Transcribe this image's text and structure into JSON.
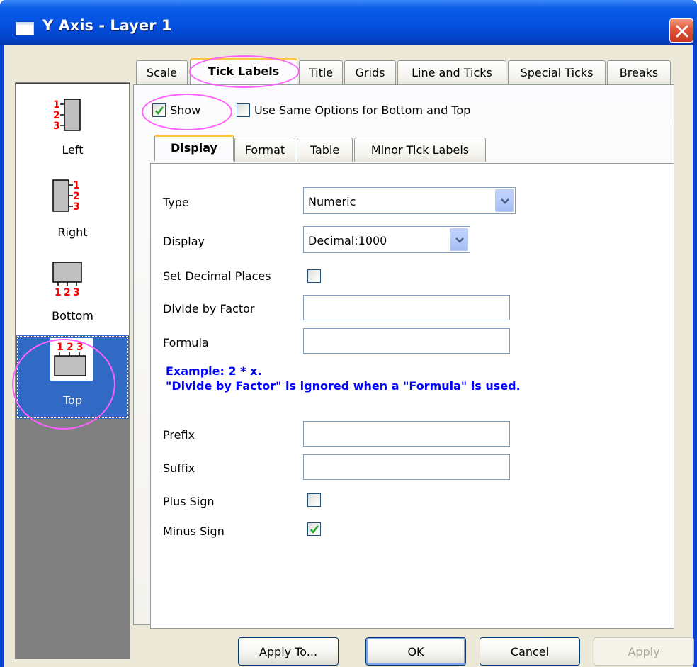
{
  "window": {
    "title": "Y Axis - Layer 1"
  },
  "sidebar": {
    "items": [
      {
        "label": "Left",
        "selected": false
      },
      {
        "label": "Right",
        "selected": false
      },
      {
        "label": "Bottom",
        "selected": false
      },
      {
        "label": "Top",
        "selected": true
      }
    ],
    "tick_digits": [
      "1",
      "2",
      "3"
    ]
  },
  "tabs": [
    {
      "label": "Scale",
      "active": false
    },
    {
      "label": "Tick Labels",
      "active": true
    },
    {
      "label": "Title",
      "active": false
    },
    {
      "label": "Grids",
      "active": false
    },
    {
      "label": "Line and Ticks",
      "active": false
    },
    {
      "label": "Special Ticks",
      "active": false
    },
    {
      "label": "Breaks",
      "active": false
    }
  ],
  "options": {
    "show": {
      "label": "Show",
      "checked": true
    },
    "same_options": {
      "label": "Use Same Options for Bottom and Top",
      "checked": false
    }
  },
  "subtabs": [
    {
      "label": "Display",
      "active": true
    },
    {
      "label": "Format",
      "active": false
    },
    {
      "label": "Table",
      "active": false
    },
    {
      "label": "Minor Tick Labels",
      "active": false
    }
  ],
  "display": {
    "type": {
      "label": "Type",
      "value": "Numeric"
    },
    "display": {
      "label": "Display",
      "value": "Decimal:1000"
    },
    "set_decimal_places": {
      "label": "Set Decimal Places",
      "checked": false
    },
    "divide_by_factor": {
      "label": "Divide by Factor",
      "value": ""
    },
    "formula": {
      "label": "Formula",
      "value": ""
    },
    "example_line1": "Example: 2 * x.",
    "example_line2": "\"Divide by Factor\" is ignored when a \"Formula\" is used.",
    "prefix": {
      "label": "Prefix",
      "value": ""
    },
    "suffix": {
      "label": "Suffix",
      "value": ""
    },
    "plus_sign": {
      "label": "Plus Sign",
      "checked": false
    },
    "minus_sign": {
      "label": "Minus Sign",
      "checked": true
    }
  },
  "buttons": {
    "apply_to": "Apply To...",
    "ok": "OK",
    "cancel": "Cancel",
    "apply": "Apply"
  },
  "colors": {
    "title_bar": "#0450e0",
    "selection": "#316ac5",
    "highlight": "#ff5fff",
    "example_text": "#0000ff",
    "tick_digits": "#ff0000",
    "check_mark": "#21a121"
  }
}
